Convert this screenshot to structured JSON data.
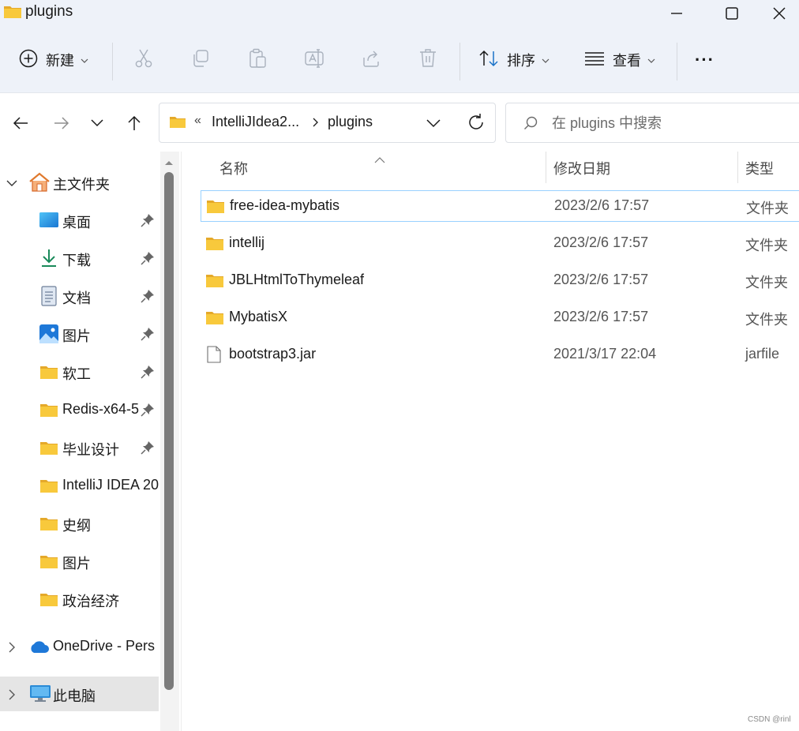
{
  "window": {
    "title": "plugins"
  },
  "toolbar": {
    "new_label": "新建",
    "sort_label": "排序",
    "view_label": "查看",
    "more_label": "···"
  },
  "address": {
    "ellipsis": "«",
    "segment1": "IntelliJIdea2...",
    "segment2": "plugins"
  },
  "search": {
    "placeholder": "在 plugins 中搜索"
  },
  "sidebar": {
    "home": "主文件夹",
    "items": [
      {
        "label": "桌面",
        "icon": "desktop-icon"
      },
      {
        "label": "下载",
        "icon": "download-icon"
      },
      {
        "label": "文档",
        "icon": "document-icon"
      },
      {
        "label": "图片",
        "icon": "pictures-icon"
      },
      {
        "label": "软工",
        "icon": "folder-icon"
      },
      {
        "label": "Redis-x64-5",
        "icon": "folder-icon"
      },
      {
        "label": "毕业设计",
        "icon": "folder-icon"
      },
      {
        "label": "IntelliJ IDEA 20",
        "icon": "folder-icon"
      },
      {
        "label": "史纲",
        "icon": "folder-icon"
      },
      {
        "label": "图片",
        "icon": "folder-icon"
      },
      {
        "label": "政治经济",
        "icon": "folder-icon"
      }
    ],
    "onedrive": "OneDrive - Pers",
    "this_pc": "此电脑"
  },
  "columns": {
    "name": "名称",
    "date": "修改日期",
    "type": "类型"
  },
  "files": [
    {
      "name": "free-idea-mybatis",
      "date": "2023/2/6 17:57",
      "type": "文件夹",
      "icon": "folder-icon"
    },
    {
      "name": "intellij",
      "date": "2023/2/6 17:57",
      "type": "文件夹",
      "icon": "folder-icon"
    },
    {
      "name": "JBLHtmlToThymeleaf",
      "date": "2023/2/6 17:57",
      "type": "文件夹",
      "icon": "folder-icon"
    },
    {
      "name": "MybatisX",
      "date": "2023/2/6 17:57",
      "type": "文件夹",
      "icon": "folder-icon"
    },
    {
      "name": "bootstrap3.jar",
      "date": "2021/3/17 22:04",
      "type": "jarfile",
      "icon": "file-icon"
    }
  ],
  "watermark": "CSDN @rinl",
  "colors": {
    "chrome_bg": "#eef2f9",
    "folder_yellow": "#f8c93c",
    "selection_border": "#99d1ff",
    "accent_blue": "#1a73c8"
  }
}
